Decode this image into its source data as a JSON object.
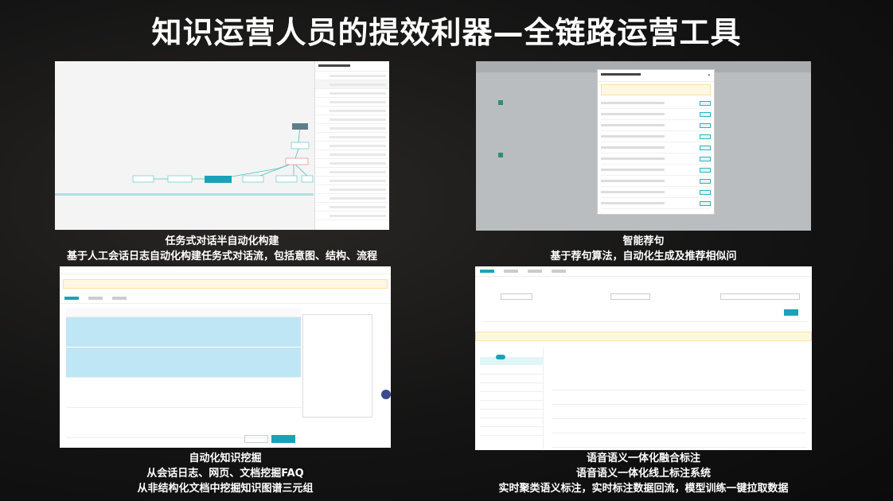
{
  "title": "知识运营人员的提效利器—全链路运营工具",
  "panels": [
    {
      "caption_lines": [
        "任务式对话半自动化构建",
        "基于人工会话日志自动化构建任务式对话流，包括意图、结构、流程"
      ]
    },
    {
      "caption_lines": [
        "智能荐句",
        "基于荐句算法，自动化生成及推荐相似问"
      ]
    },
    {
      "caption_lines": [
        "自动化知识挖掘",
        "从会话日志、网页、文档挖掘FAQ",
        "从非结构化文档中挖掘知识图谱三元组"
      ]
    },
    {
      "caption_lines": [
        "语音语义一体化融合标注",
        "语音语义一体化线上标注系统",
        "实时聚类语义标注，实时标注数据回流，模型训练一键拉取数据"
      ]
    }
  ],
  "colors": {
    "accent": "#1aa3b8",
    "highlight_row": "#bfe6f5",
    "warning_bg": "#fff8e1"
  }
}
